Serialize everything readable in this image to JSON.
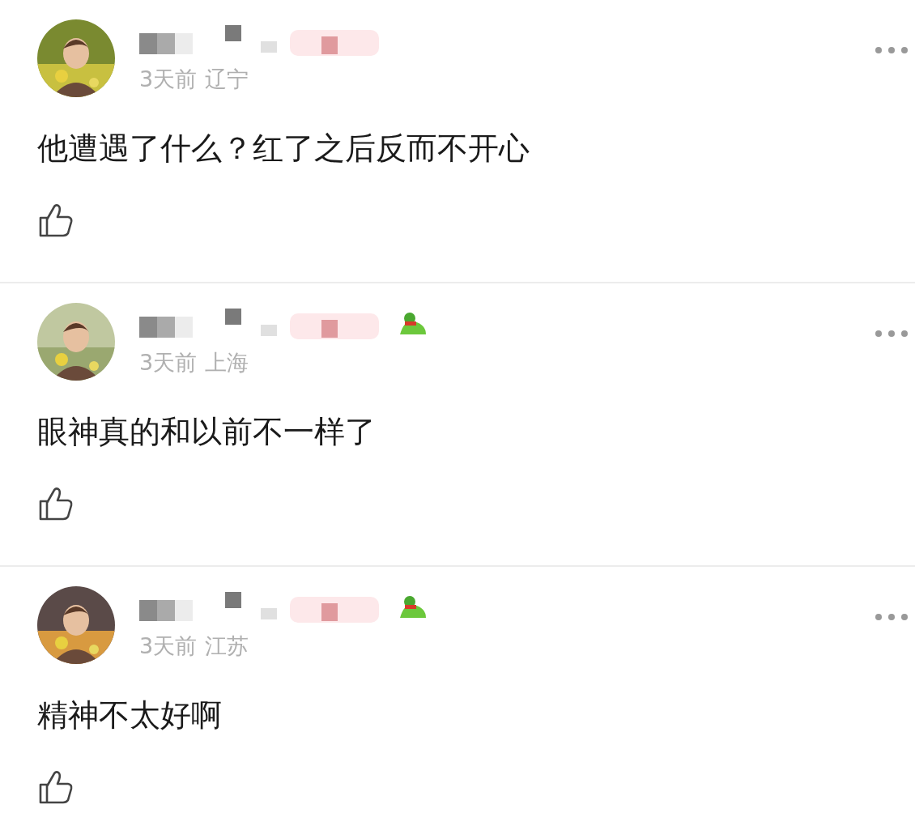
{
  "comments": [
    {
      "time": "3天前",
      "location": "辽宁",
      "text": "他遭遇了什么？红了之后反而不开心",
      "sticker": false
    },
    {
      "time": "3天前",
      "location": "上海",
      "text": "眼神真的和以前不一样了",
      "sticker": true
    },
    {
      "time": "3天前",
      "location": "江苏",
      "text": "精神不太好啊",
      "sticker": true
    }
  ]
}
